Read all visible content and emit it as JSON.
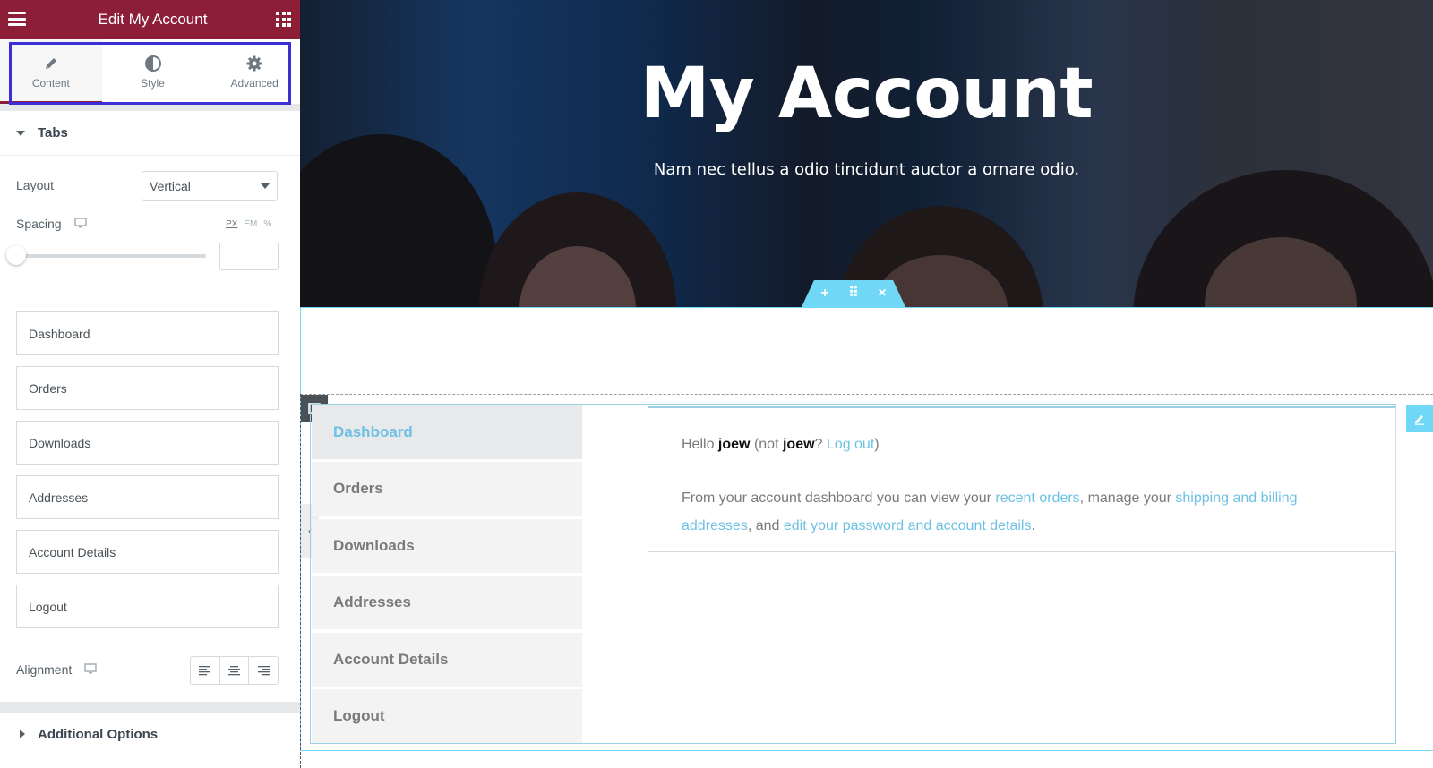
{
  "panel": {
    "title": "Edit My Account",
    "tabs": [
      {
        "label": "Content",
        "icon": "pencil-icon",
        "active": true
      },
      {
        "label": "Style",
        "icon": "half-circle-icon",
        "active": false
      },
      {
        "label": "Advanced",
        "icon": "gear-icon",
        "active": false
      }
    ],
    "section_tabs": "Tabs",
    "layout": {
      "label": "Layout",
      "value": "Vertical"
    },
    "spacing": {
      "label": "Spacing",
      "units": [
        "PX",
        "EM",
        "%"
      ],
      "active_unit": "PX",
      "value": "",
      "slider_fraction": 0
    },
    "tab_fields": [
      "Dashboard",
      "Orders",
      "Downloads",
      "Addresses",
      "Account Details",
      "Logout"
    ],
    "alignment": {
      "label": "Alignment",
      "options": [
        "left",
        "center",
        "right"
      ]
    },
    "section_additional": "Additional Options"
  },
  "preview": {
    "hero": {
      "title": "My Account",
      "subtitle": "Nam nec tellus a odio tincidunt auctor a ornare odio."
    },
    "section_handle": {
      "add": "+",
      "move": "⠿",
      "close": "×"
    },
    "nav": [
      "Dashboard",
      "Orders",
      "Downloads",
      "Addresses",
      "Account Details",
      "Logout"
    ],
    "active_nav": "Dashboard",
    "content": {
      "hello": "Hello",
      "user": "joew",
      "not": "(not",
      "user2": "joew",
      "q": "?",
      "logout": "Log out",
      "close_paren": ")",
      "p2_a": "From your account dashboard you can view your",
      "link_orders": "recent orders",
      "p2_b": ", manage your",
      "link_addresses": "shipping and billing addresses",
      "p2_c": ", and",
      "link_account": "edit your password and account details",
      "p2_d": "."
    },
    "accent_color": "#6ec1e4",
    "brand_color": "#8d1e37"
  }
}
